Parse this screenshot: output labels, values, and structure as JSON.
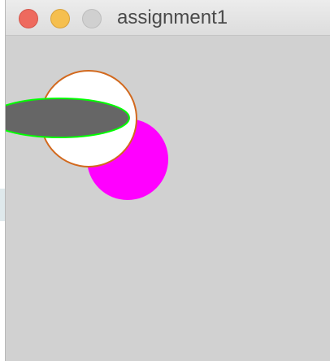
{
  "window": {
    "title": "assignment1",
    "buttons": {
      "close": "close-button",
      "minimize": "minimize-button",
      "zoom": "zoom-button"
    }
  },
  "canvas": {
    "background_color": "#d1d1d1",
    "shapes": [
      {
        "name": "magenta-circle",
        "fill": "#ff00ff",
        "stroke": "none"
      },
      {
        "name": "white-circle",
        "fill": "#ffffff",
        "stroke": "#d2691e"
      },
      {
        "name": "gray-ellipse",
        "fill": "#666666",
        "stroke": "#00ff00"
      }
    ]
  }
}
